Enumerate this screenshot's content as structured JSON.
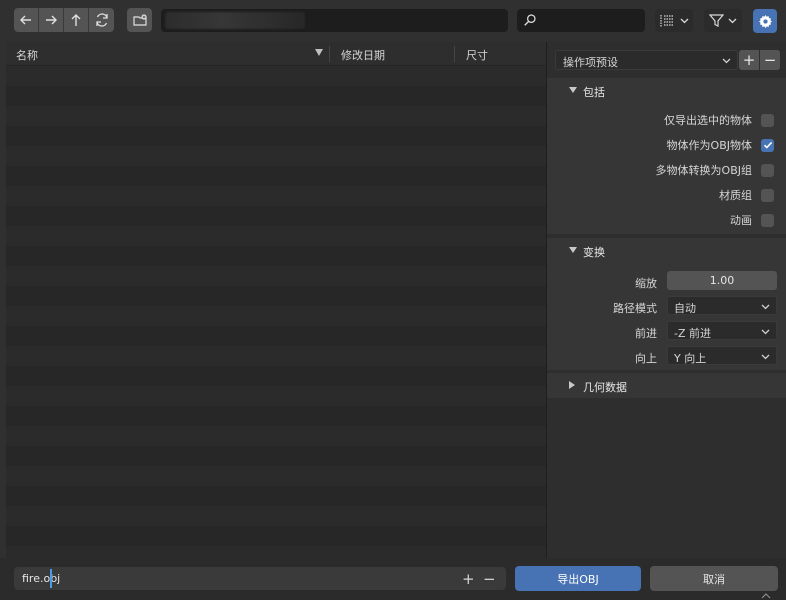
{
  "toolbar": {
    "path_value": "",
    "search_value": "",
    "nav_buttons": [
      "back-icon",
      "forward-icon",
      "parent-dir-icon",
      "refresh-icon"
    ],
    "new_folder_icon": "new-folder-icon",
    "display_mode_icon": "list-view-icon",
    "filter_icon": "filter-icon",
    "settings_icon": "gear-icon"
  },
  "filelist": {
    "columns": [
      "名称",
      "修改日期",
      "尺寸"
    ]
  },
  "sidebar": {
    "preset_label": "操作项预设",
    "preset_add": "+",
    "preset_remove": "−",
    "include": {
      "title": "包括",
      "options": [
        {
          "label": "仅导出选中的物体",
          "checked": false
        },
        {
          "label": "物体作为OBJ物体",
          "checked": true
        },
        {
          "label": "多物体转换为OBJ组",
          "checked": false
        },
        {
          "label": "材质组",
          "checked": false
        },
        {
          "label": "动画",
          "checked": false
        }
      ]
    },
    "transform": {
      "title": "变换",
      "scale_label": "缩放",
      "scale_value": "1.00",
      "path_mode_label": "路径模式",
      "path_mode_value": "自动",
      "forward_label": "前进",
      "forward_value": "-Z 前进",
      "up_label": "向上",
      "up_value": "Y 向上"
    },
    "geometry": {
      "title": "几何数据"
    }
  },
  "bottom": {
    "filename": "fire.obj",
    "plus": "+",
    "minus": "−",
    "export_label": "导出OBJ",
    "cancel_label": "取消"
  },
  "colors": {
    "accent": "#4772b3",
    "background": "#2b2b2b",
    "panel": "#363636",
    "button": "#545454"
  }
}
